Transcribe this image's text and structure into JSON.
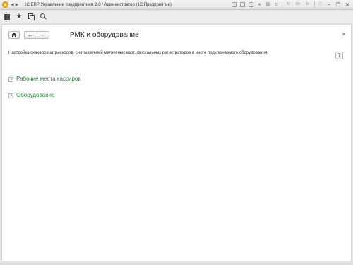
{
  "window": {
    "title": "1С:ERP Управление предприятием 2.0 / Администратор  (1С:Предприятие)",
    "memory_buttons": [
      "M",
      "M+",
      "M-"
    ]
  },
  "form": {
    "title": "РМК и оборудование",
    "description": "Настройка сканеров штрихкодов, считывателей магнитных карт, фискальных регистраторов и иного подключаемого оборудования.",
    "help_label": "?",
    "close_label": "×",
    "back_label": "←",
    "forward_label": "→"
  },
  "groups": [
    {
      "label": "Рабочие места кассиров"
    },
    {
      "label": "Оборудование"
    }
  ],
  "colors": {
    "link": "#2a8a3c"
  }
}
